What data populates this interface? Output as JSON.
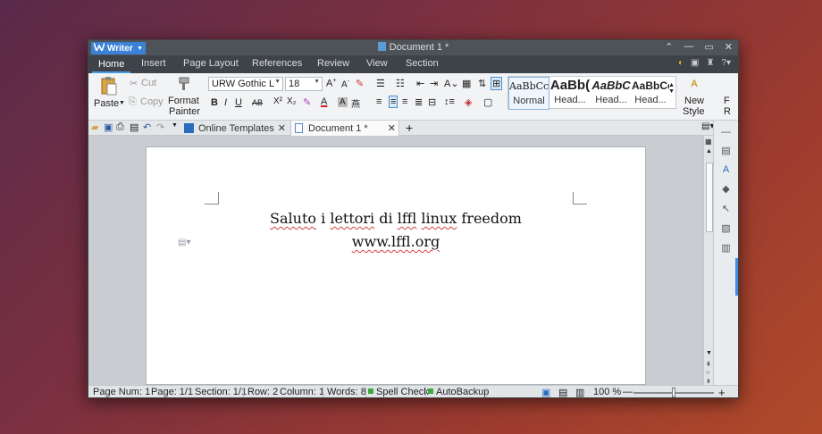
{
  "app": {
    "name": "Writer",
    "doc_title": "Document 1 *"
  },
  "menu_tabs": [
    "Home",
    "Insert",
    "Page Layout",
    "References",
    "Review",
    "View",
    "Section"
  ],
  "ribbon": {
    "paste": "Paste",
    "cut": "Cut",
    "copy": "Copy",
    "format_painter_1": "Format",
    "format_painter_2": "Painter",
    "font_name": "URW Gothic L",
    "font_size": "18",
    "styles": [
      {
        "sample": "AaBbCcDd",
        "label": "Normal"
      },
      {
        "sample": "AaBb(",
        "label": "Head..."
      },
      {
        "sample": "AaBbC",
        "label": "Head..."
      },
      {
        "sample": "AaBbCc",
        "label": "Head..."
      }
    ],
    "new_style_1": "New",
    "new_style_2": "Style",
    "overflow_1": "F",
    "overflow_2": "R"
  },
  "doc_tabs": {
    "templates": "Online Templates",
    "document": "Document 1 *"
  },
  "document": {
    "line1_words": [
      "Saluto",
      "i",
      "lettori",
      "di",
      "lffl",
      "linux",
      "freedom"
    ],
    "line2": "www.lffl.org"
  },
  "status": {
    "page_num": "Page Num: 1",
    "page": "Page: 1/1",
    "section": "Section: 1/1",
    "row": "Row: 2",
    "column": "Column: 1",
    "words": "Words: 8",
    "spell": "Spell Check",
    "autobackup": "AutoBackup",
    "zoom": "100 %"
  },
  "colors": {
    "accent": "#3b82d6",
    "titlebar": "#4d5359",
    "spell_underline": "#d04040"
  },
  "icons": [
    "paste-icon",
    "cut-icon",
    "copy-icon",
    "format-painter-icon",
    "bold-icon",
    "italic-icon",
    "underline-icon",
    "new-style-icon",
    "save-icon",
    "print-icon",
    "undo-icon",
    "redo-icon",
    "add-tab-icon"
  ]
}
